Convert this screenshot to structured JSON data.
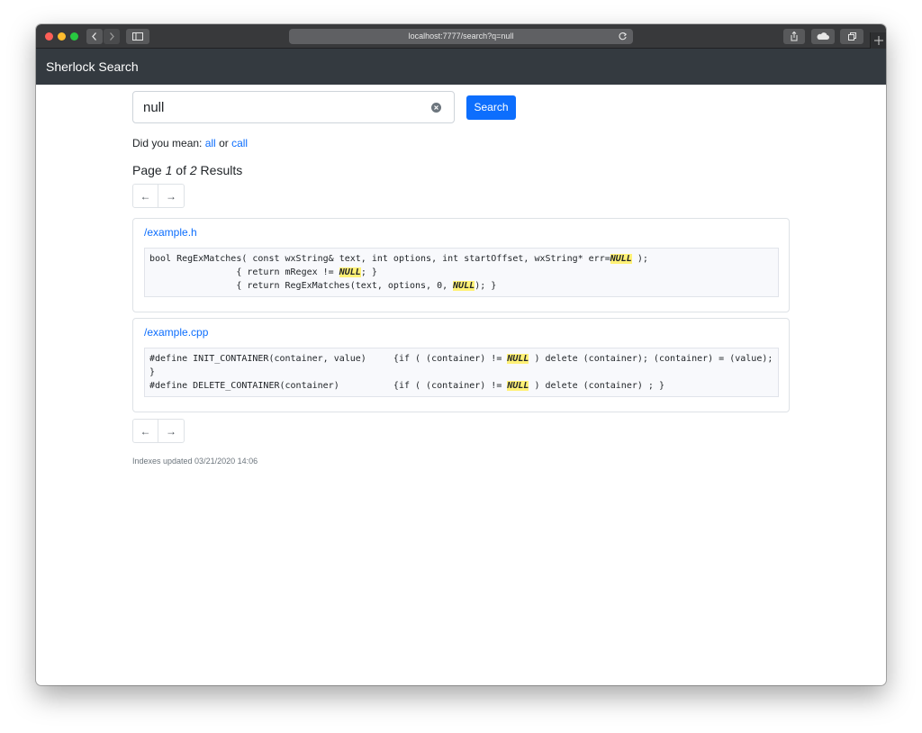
{
  "browser": {
    "url": "localhost:7777/search?q=null"
  },
  "navbar": {
    "brand": "Sherlock Search"
  },
  "search": {
    "query": "null",
    "button_label": "Search"
  },
  "suggestions": {
    "prefix": "Did you mean:",
    "first": "all",
    "separator": "or",
    "second": "call"
  },
  "pagination": {
    "page_word": "Page",
    "current": "1",
    "of_word": "of",
    "total": "2",
    "results_word": "Results",
    "prev_label": "←",
    "next_label": "→"
  },
  "results": [
    {
      "path": "/example.h",
      "lines": [
        [
          {
            "text": "bool RegExMatches( const wxString& text, int options, int startOffset, wxString* err=",
            "hl": false
          },
          {
            "text": "NULL",
            "hl": true
          },
          {
            "text": " );",
            "hl": false
          }
        ],
        [
          {
            "text": "                { return mRegex != ",
            "hl": false
          },
          {
            "text": "NULL",
            "hl": true
          },
          {
            "text": "; }",
            "hl": false
          }
        ],
        [
          {
            "text": "                { return RegExMatches(text, options, 0, ",
            "hl": false
          },
          {
            "text": "NULL",
            "hl": true
          },
          {
            "text": "); }",
            "hl": false
          }
        ]
      ]
    },
    {
      "path": "/example.cpp",
      "lines": [
        [
          {
            "text": "#define INIT_CONTAINER(container, value)     {if ( (container) != ",
            "hl": false
          },
          {
            "text": "NULL",
            "hl": true
          },
          {
            "text": " ) delete (container); (container) = (value); }",
            "hl": false
          }
        ],
        [
          {
            "text": "#define DELETE_CONTAINER(container)          {if ( (container) != ",
            "hl": false
          },
          {
            "text": "NULL",
            "hl": true
          },
          {
            "text": " ) delete (container) ; }",
            "hl": false
          }
        ]
      ]
    }
  ],
  "footer": {
    "indexes_updated": "Indexes updated 03/21/2020 14:06"
  },
  "colors": {
    "primary": "#0d6efd",
    "navbar": "#343a40",
    "highlight": "#fff176"
  }
}
